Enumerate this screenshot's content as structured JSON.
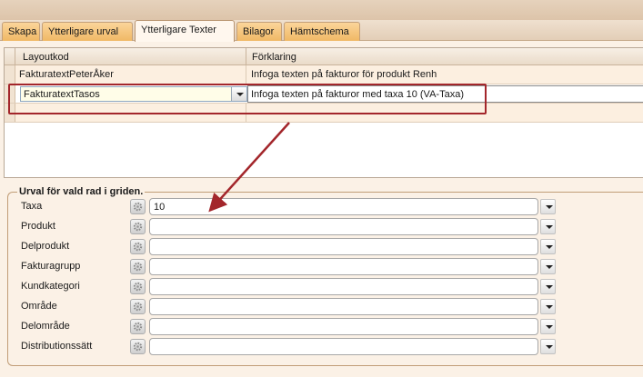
{
  "tabs": [
    {
      "label": "Skapa",
      "active": false
    },
    {
      "label": "Ytterligare urval",
      "active": false
    },
    {
      "label": "Ytterligare Texter",
      "active": true
    },
    {
      "label": "Bilagor",
      "active": false
    },
    {
      "label": "Hämtschema",
      "active": false
    }
  ],
  "grid": {
    "columns": [
      "Layoutkod",
      "Förklaring"
    ],
    "rows": [
      {
        "layoutkod": "FakturatextPeterÅker",
        "forklaring": "Infoga texten på fakturor för produkt Renh"
      },
      {
        "layoutkod": "FakturatextTasos",
        "forklaring": "Infoga texten på fakturor med taxa 10 (VA-Taxa)"
      },
      {
        "layoutkod": "",
        "forklaring": ""
      }
    ]
  },
  "filter_group": {
    "legend": "Urval för vald rad i griden.",
    "fields": [
      {
        "label": "Taxa",
        "value": "10"
      },
      {
        "label": "Produkt",
        "value": ""
      },
      {
        "label": "Delprodukt",
        "value": ""
      },
      {
        "label": "Fakturagrupp",
        "value": ""
      },
      {
        "label": "Kundkategori",
        "value": ""
      },
      {
        "label": "Område",
        "value": ""
      },
      {
        "label": "Delområde",
        "value": ""
      },
      {
        "label": "Distributionssätt",
        "value": ""
      }
    ]
  },
  "colors": {
    "tab_inactive": "#f0b865",
    "tab_active": "#fff7ee",
    "annotation": "#a3262b",
    "background": "#fbf1e6"
  },
  "icons": {
    "field_button": "gear-icon",
    "dropdown": "chevron-down-icon"
  }
}
